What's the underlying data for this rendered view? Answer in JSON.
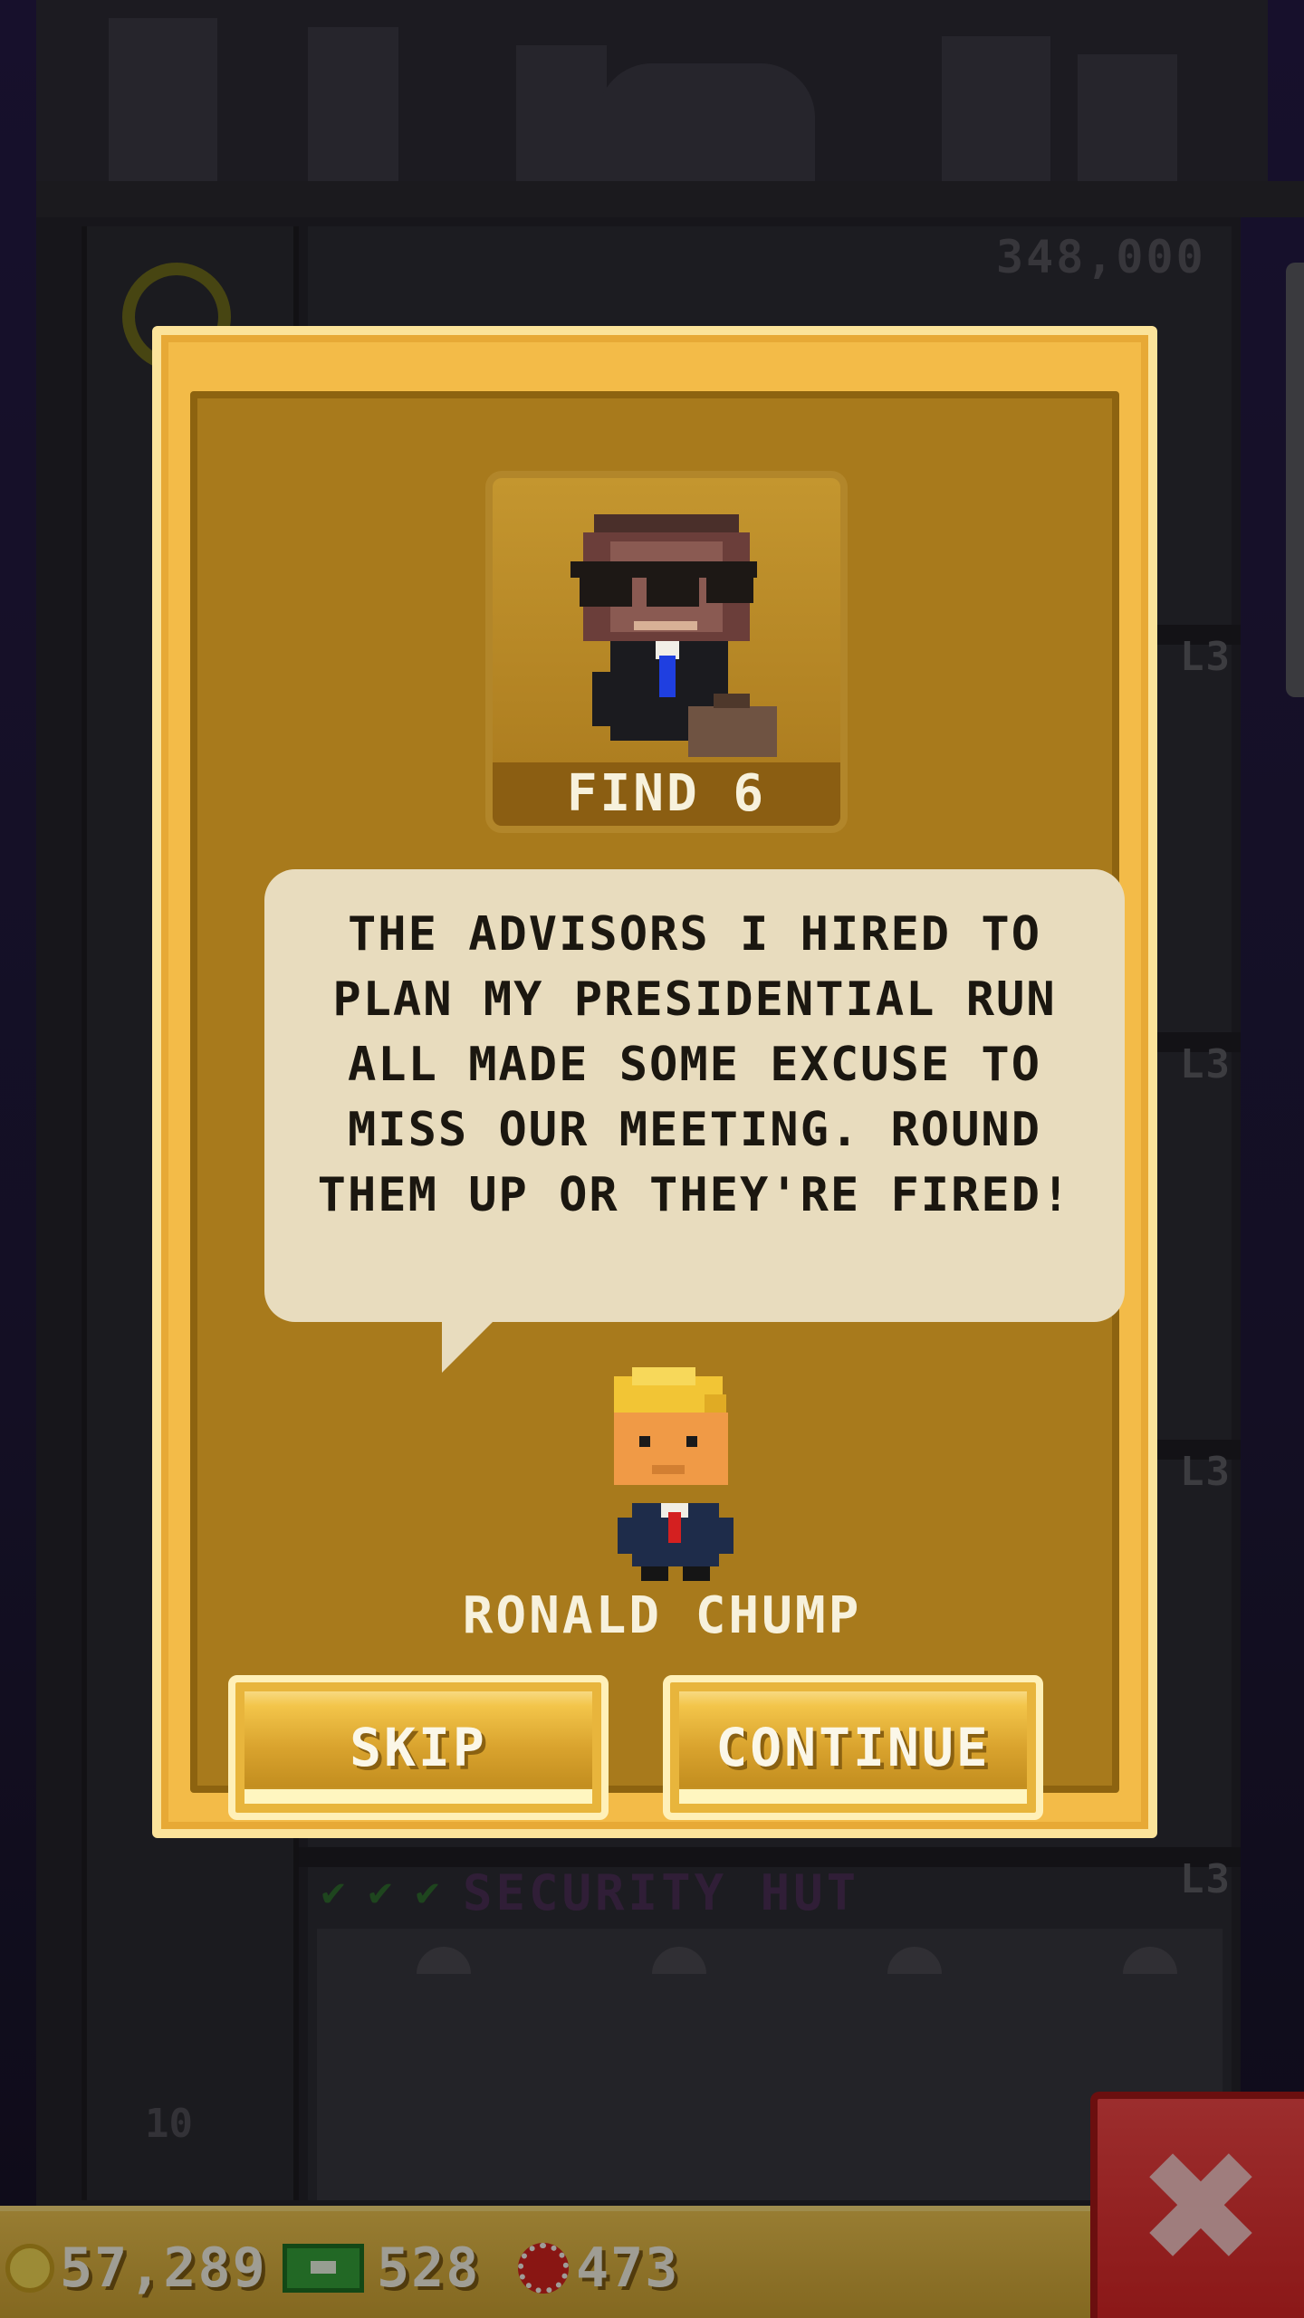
{
  "background": {
    "top_population": "348,000",
    "floor_level_tags": [
      "L3",
      "L3",
      "L3",
      "L3"
    ],
    "security_floor": {
      "label": "SECURITY HUT",
      "level": "L3",
      "checks": [
        "✔",
        "✔",
        "✔"
      ]
    },
    "floor_number": "10"
  },
  "quest_modal": {
    "portrait_caption": "FIND 6",
    "message": "THE ADVISORS I HIRED TO PLAN MY PRESIDENTIAL RUN ALL MADE SOME EXCUSE TO MISS OUR MEETING. ROUND THEM UP OR THEY'RE FIRED!",
    "speaker_name": "RONALD CHUMP",
    "skip_label": "SKIP",
    "continue_label": "CONTINUE"
  },
  "currency_bar": {
    "coins": "57,289",
    "bux": "528",
    "gems": "473"
  },
  "close_button": {
    "icon": "close-icon",
    "glyph": "✖"
  },
  "colors": {
    "modal_gold": "#f3bb48",
    "modal_inner": "#a87a1c",
    "bubble": "#e8dcbe",
    "close_red": "#e33434",
    "currency_bar": "#e2b643"
  }
}
